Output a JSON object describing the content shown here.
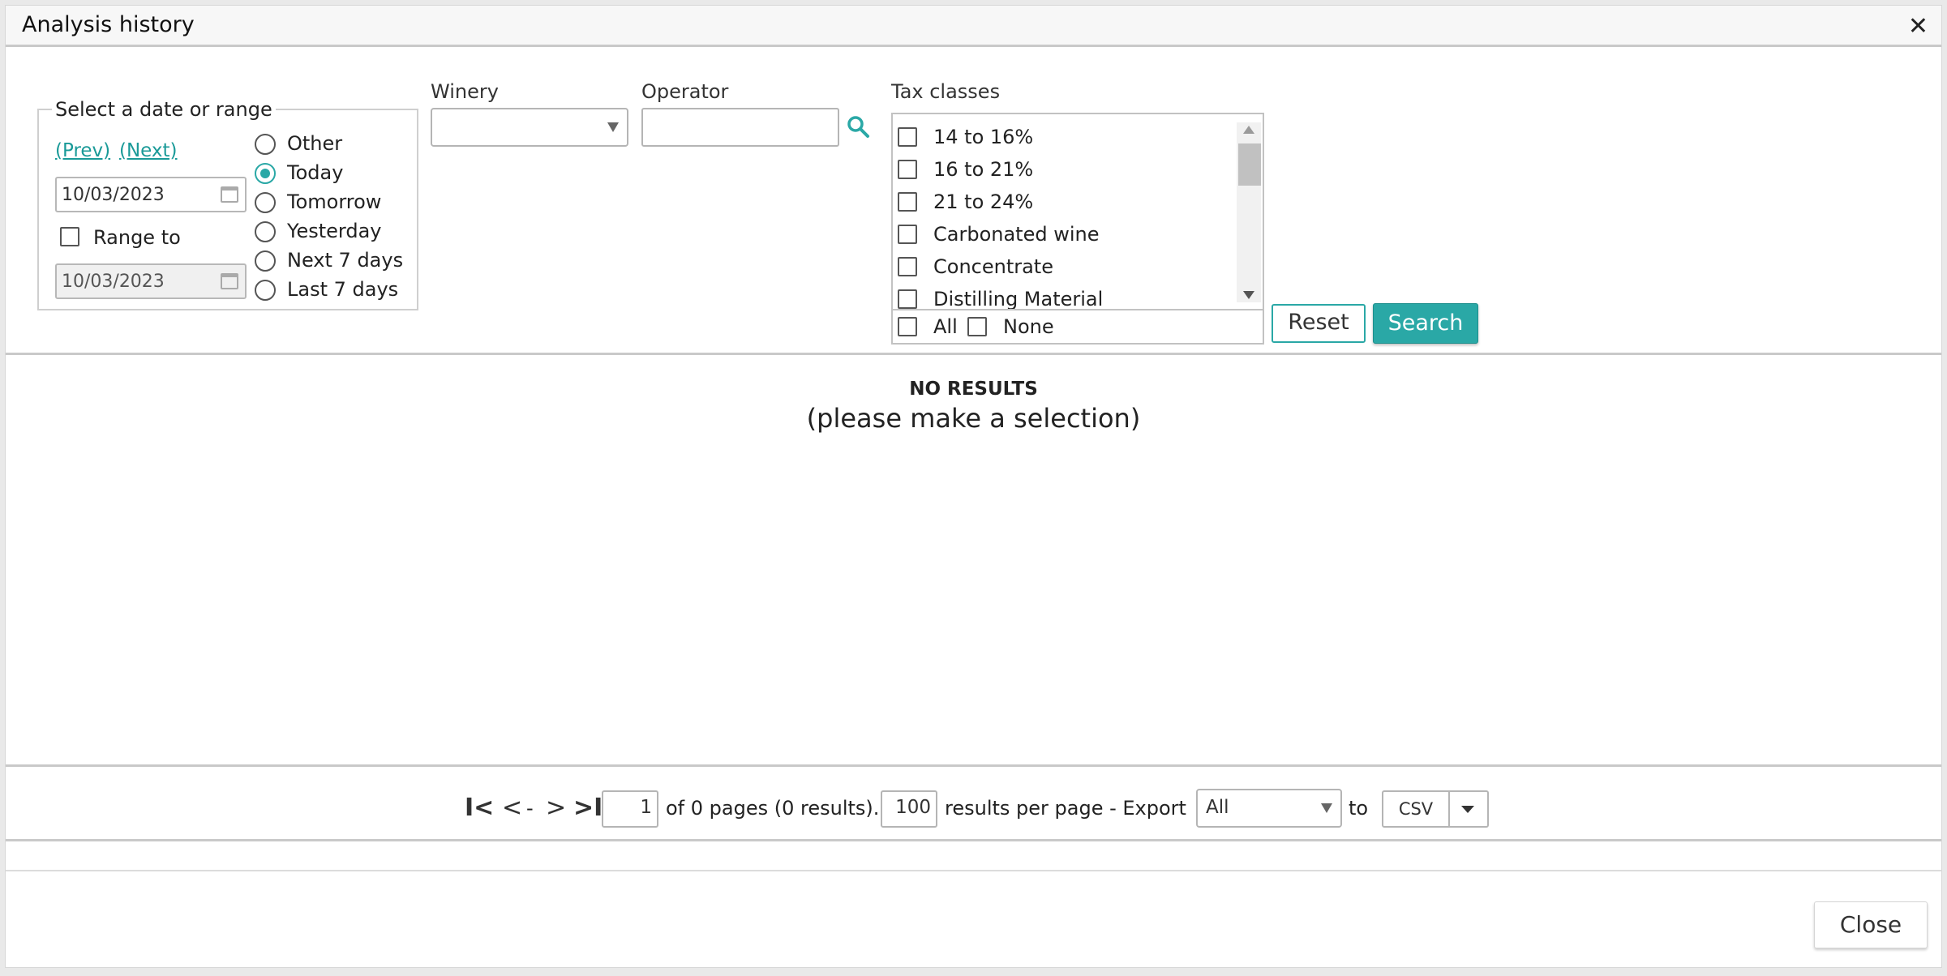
{
  "window": {
    "title": "Analysis history",
    "close_glyph": "✕"
  },
  "date_range": {
    "legend": "Select a date or range",
    "prev_label": "(Prev)",
    "next_label": "(Next)",
    "from_date": "10/03/2023",
    "range_to_label": "Range to",
    "range_to_checked": false,
    "to_date": "10/03/2023",
    "options": [
      {
        "label": "Other",
        "selected": false
      },
      {
        "label": "Today",
        "selected": true
      },
      {
        "label": "Tomorrow",
        "selected": false
      },
      {
        "label": "Yesterday",
        "selected": false
      },
      {
        "label": "Next 7 days",
        "selected": false
      },
      {
        "label": "Last 7 days",
        "selected": false
      }
    ]
  },
  "winery": {
    "label": "Winery",
    "value": ""
  },
  "operator": {
    "label": "Operator",
    "value": ""
  },
  "tax_classes": {
    "label": "Tax classes",
    "items": [
      {
        "label": "14 to 16%",
        "checked": false
      },
      {
        "label": "16 to 21%",
        "checked": false
      },
      {
        "label": "21 to 24%",
        "checked": false
      },
      {
        "label": "Carbonated wine",
        "checked": false
      },
      {
        "label": "Concentrate",
        "checked": false
      },
      {
        "label": "Distilling Material",
        "checked": false
      }
    ],
    "all_label": "All",
    "none_label": "None"
  },
  "actions": {
    "reset_label": "Reset",
    "search_label": "Search"
  },
  "results": {
    "title": "NO RESULTS",
    "subtitle": "(please make a selection)"
  },
  "pager": {
    "first_glyph": "I<",
    "prev_glyph": "<",
    "sep": "-",
    "next_glyph": ">",
    "last_glyph": ">I",
    "page": "1",
    "of_text": "of 0 pages (0 results).",
    "per_page": "100",
    "per_page_text": "results per page - Export",
    "export_scope": "All",
    "to_text": "to",
    "export_format": "CSV"
  },
  "footer": {
    "close_label": "Close"
  },
  "colors": {
    "accent": "#2aa8a6",
    "link": "#1a9a98"
  }
}
